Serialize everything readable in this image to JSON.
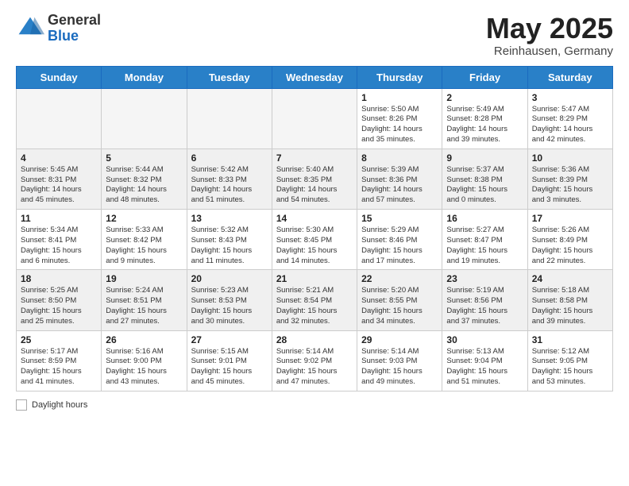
{
  "header": {
    "logo_general": "General",
    "logo_blue": "Blue",
    "title": "May 2025",
    "subtitle": "Reinhausen, Germany"
  },
  "weekdays": [
    "Sunday",
    "Monday",
    "Tuesday",
    "Wednesday",
    "Thursday",
    "Friday",
    "Saturday"
  ],
  "weeks": [
    [
      {
        "day": "",
        "info": "",
        "empty": true
      },
      {
        "day": "",
        "info": "",
        "empty": true
      },
      {
        "day": "",
        "info": "",
        "empty": true
      },
      {
        "day": "",
        "info": "",
        "empty": true
      },
      {
        "day": "1",
        "info": "Sunrise: 5:50 AM\nSunset: 8:26 PM\nDaylight: 14 hours\nand 35 minutes."
      },
      {
        "day": "2",
        "info": "Sunrise: 5:49 AM\nSunset: 8:28 PM\nDaylight: 14 hours\nand 39 minutes."
      },
      {
        "day": "3",
        "info": "Sunrise: 5:47 AM\nSunset: 8:29 PM\nDaylight: 14 hours\nand 42 minutes."
      }
    ],
    [
      {
        "day": "4",
        "info": "Sunrise: 5:45 AM\nSunset: 8:31 PM\nDaylight: 14 hours\nand 45 minutes."
      },
      {
        "day": "5",
        "info": "Sunrise: 5:44 AM\nSunset: 8:32 PM\nDaylight: 14 hours\nand 48 minutes."
      },
      {
        "day": "6",
        "info": "Sunrise: 5:42 AM\nSunset: 8:33 PM\nDaylight: 14 hours\nand 51 minutes."
      },
      {
        "day": "7",
        "info": "Sunrise: 5:40 AM\nSunset: 8:35 PM\nDaylight: 14 hours\nand 54 minutes."
      },
      {
        "day": "8",
        "info": "Sunrise: 5:39 AM\nSunset: 8:36 PM\nDaylight: 14 hours\nand 57 minutes."
      },
      {
        "day": "9",
        "info": "Sunrise: 5:37 AM\nSunset: 8:38 PM\nDaylight: 15 hours\nand 0 minutes."
      },
      {
        "day": "10",
        "info": "Sunrise: 5:36 AM\nSunset: 8:39 PM\nDaylight: 15 hours\nand 3 minutes."
      }
    ],
    [
      {
        "day": "11",
        "info": "Sunrise: 5:34 AM\nSunset: 8:41 PM\nDaylight: 15 hours\nand 6 minutes."
      },
      {
        "day": "12",
        "info": "Sunrise: 5:33 AM\nSunset: 8:42 PM\nDaylight: 15 hours\nand 9 minutes."
      },
      {
        "day": "13",
        "info": "Sunrise: 5:32 AM\nSunset: 8:43 PM\nDaylight: 15 hours\nand 11 minutes."
      },
      {
        "day": "14",
        "info": "Sunrise: 5:30 AM\nSunset: 8:45 PM\nDaylight: 15 hours\nand 14 minutes."
      },
      {
        "day": "15",
        "info": "Sunrise: 5:29 AM\nSunset: 8:46 PM\nDaylight: 15 hours\nand 17 minutes."
      },
      {
        "day": "16",
        "info": "Sunrise: 5:27 AM\nSunset: 8:47 PM\nDaylight: 15 hours\nand 19 minutes."
      },
      {
        "day": "17",
        "info": "Sunrise: 5:26 AM\nSunset: 8:49 PM\nDaylight: 15 hours\nand 22 minutes."
      }
    ],
    [
      {
        "day": "18",
        "info": "Sunrise: 5:25 AM\nSunset: 8:50 PM\nDaylight: 15 hours\nand 25 minutes."
      },
      {
        "day": "19",
        "info": "Sunrise: 5:24 AM\nSunset: 8:51 PM\nDaylight: 15 hours\nand 27 minutes."
      },
      {
        "day": "20",
        "info": "Sunrise: 5:23 AM\nSunset: 8:53 PM\nDaylight: 15 hours\nand 30 minutes."
      },
      {
        "day": "21",
        "info": "Sunrise: 5:21 AM\nSunset: 8:54 PM\nDaylight: 15 hours\nand 32 minutes."
      },
      {
        "day": "22",
        "info": "Sunrise: 5:20 AM\nSunset: 8:55 PM\nDaylight: 15 hours\nand 34 minutes."
      },
      {
        "day": "23",
        "info": "Sunrise: 5:19 AM\nSunset: 8:56 PM\nDaylight: 15 hours\nand 37 minutes."
      },
      {
        "day": "24",
        "info": "Sunrise: 5:18 AM\nSunset: 8:58 PM\nDaylight: 15 hours\nand 39 minutes."
      }
    ],
    [
      {
        "day": "25",
        "info": "Sunrise: 5:17 AM\nSunset: 8:59 PM\nDaylight: 15 hours\nand 41 minutes."
      },
      {
        "day": "26",
        "info": "Sunrise: 5:16 AM\nSunset: 9:00 PM\nDaylight: 15 hours\nand 43 minutes."
      },
      {
        "day": "27",
        "info": "Sunrise: 5:15 AM\nSunset: 9:01 PM\nDaylight: 15 hours\nand 45 minutes."
      },
      {
        "day": "28",
        "info": "Sunrise: 5:14 AM\nSunset: 9:02 PM\nDaylight: 15 hours\nand 47 minutes."
      },
      {
        "day": "29",
        "info": "Sunrise: 5:14 AM\nSunset: 9:03 PM\nDaylight: 15 hours\nand 49 minutes."
      },
      {
        "day": "30",
        "info": "Sunrise: 5:13 AM\nSunset: 9:04 PM\nDaylight: 15 hours\nand 51 minutes."
      },
      {
        "day": "31",
        "info": "Sunrise: 5:12 AM\nSunset: 9:05 PM\nDaylight: 15 hours\nand 53 minutes."
      }
    ]
  ],
  "footer": {
    "label": "Daylight hours"
  }
}
